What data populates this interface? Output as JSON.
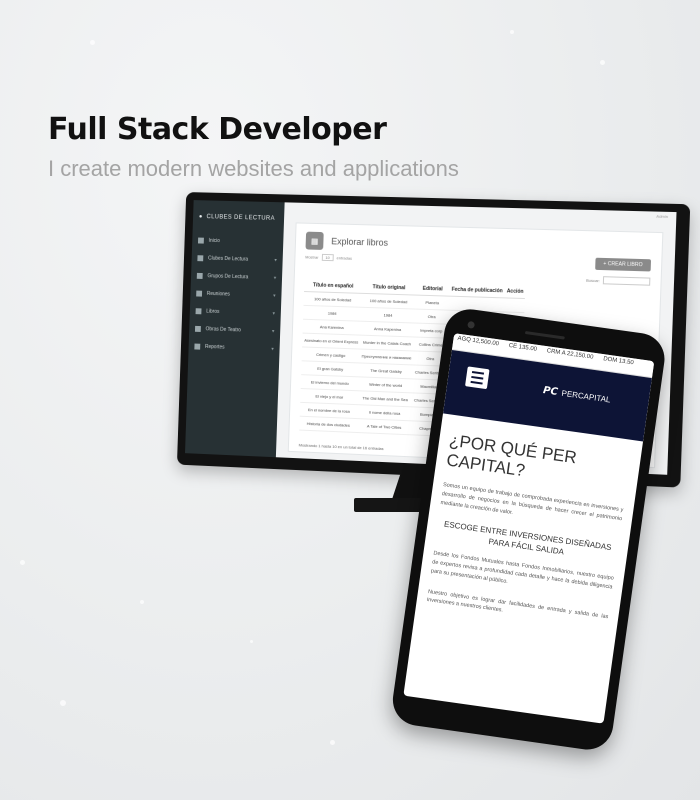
{
  "hero": {
    "title": "Full Stack Developer",
    "subtitle": "I create modern websites and applications"
  },
  "monitor": {
    "corner_text": "Admin",
    "sidebar": {
      "brand": "CLUBES DE LECTURA",
      "items": [
        {
          "label": "Inicio",
          "icon": "grid-icon",
          "has_children": false
        },
        {
          "label": "Clubes De Lectura",
          "icon": "book-club-icon",
          "has_children": true
        },
        {
          "label": "Grupos De Lectura",
          "icon": "users-icon",
          "has_children": true
        },
        {
          "label": "Reuniones",
          "icon": "calendar-icon",
          "has_children": true
        },
        {
          "label": "Libros",
          "icon": "book-icon",
          "has_children": true
        },
        {
          "label": "Obras De Teatro",
          "icon": "theater-icon",
          "has_children": true
        },
        {
          "label": "Reportes",
          "icon": "report-icon",
          "has_children": true
        }
      ]
    },
    "card": {
      "title": "Explorar libros",
      "create_button": "+ CREAR LIBRO",
      "show_label": "Mostrar",
      "show_value": "10",
      "entries_label": "entradas",
      "search_label": "Buscar:",
      "columns": [
        "Título en español",
        "Título original",
        "Editorial",
        "Fecha de publicación",
        "Acción"
      ],
      "rows": [
        [
          "100 años de Soledad",
          "100 años de Soledad",
          "Planeta",
          "",
          ""
        ],
        [
          "1984",
          "1984",
          "Otra",
          "",
          ""
        ],
        [
          "Ana Karenina",
          "Anna Kapenina",
          "Impreta corp",
          "",
          ""
        ],
        [
          "Asesinato en el Orient Express",
          "Murder in the Calais Coach",
          "Collins Crime",
          "",
          ""
        ],
        [
          "Crimen y castigo",
          "Преступление и наказание",
          "Otra",
          "",
          ""
        ],
        [
          "El gran Gatsby",
          "The Great Gatsby",
          "Charles Scribner",
          "",
          ""
        ],
        [
          "El invierno del mundo",
          "Winter of the world",
          "Macmillan",
          "",
          ""
        ],
        [
          "El viejo y el mar",
          "The Old Man and the Sea",
          "Charles Scribner",
          "",
          ""
        ],
        [
          "En el nombre de la rosa",
          "Il nome della rosa",
          "Bompiani",
          "",
          ""
        ],
        [
          "Historia de dos ciudades",
          "A Tale of Two Cities",
          "Chapman",
          "",
          ""
        ]
      ],
      "footer": "Mostrando 1 hasta 10 en un total de 16 entradas"
    }
  },
  "phone": {
    "ticker": [
      "AGQ 12,500.00",
      "CE 135.00",
      "CRM A 22,150.00",
      "DOM 13.50"
    ],
    "logo_text": "PERCAPITAL",
    "logo_mark": "PC",
    "heading": "¿POR QUÉ PER CAPITAL?",
    "paragraph1": "Somos un equipo de trabajo de comprobada experiencia en inversiones y desarrollo de negocios en la búsqueda de hacer crecer el patrimonio mediante la creación de valor.",
    "subheading": "ESCOGE ENTRE INVERSIONES DISEÑADAS PARA FÁCIL SALIDA",
    "paragraph2": "Desde los Fondos Mutuales hasta Fondos Inmobiliarios, nuestro equipo de expertos revisa a profundidad cada detalle y hace la debida diligencia para su presentación al público.",
    "paragraph3": "Nuestro objetivo es lograr dar facilidades de entrada y salida de las inversiones a nuestros clientes."
  },
  "colors": {
    "sidebar": "#273134",
    "phone_header": "#0d1436",
    "create_button": "#8a8a8a"
  }
}
